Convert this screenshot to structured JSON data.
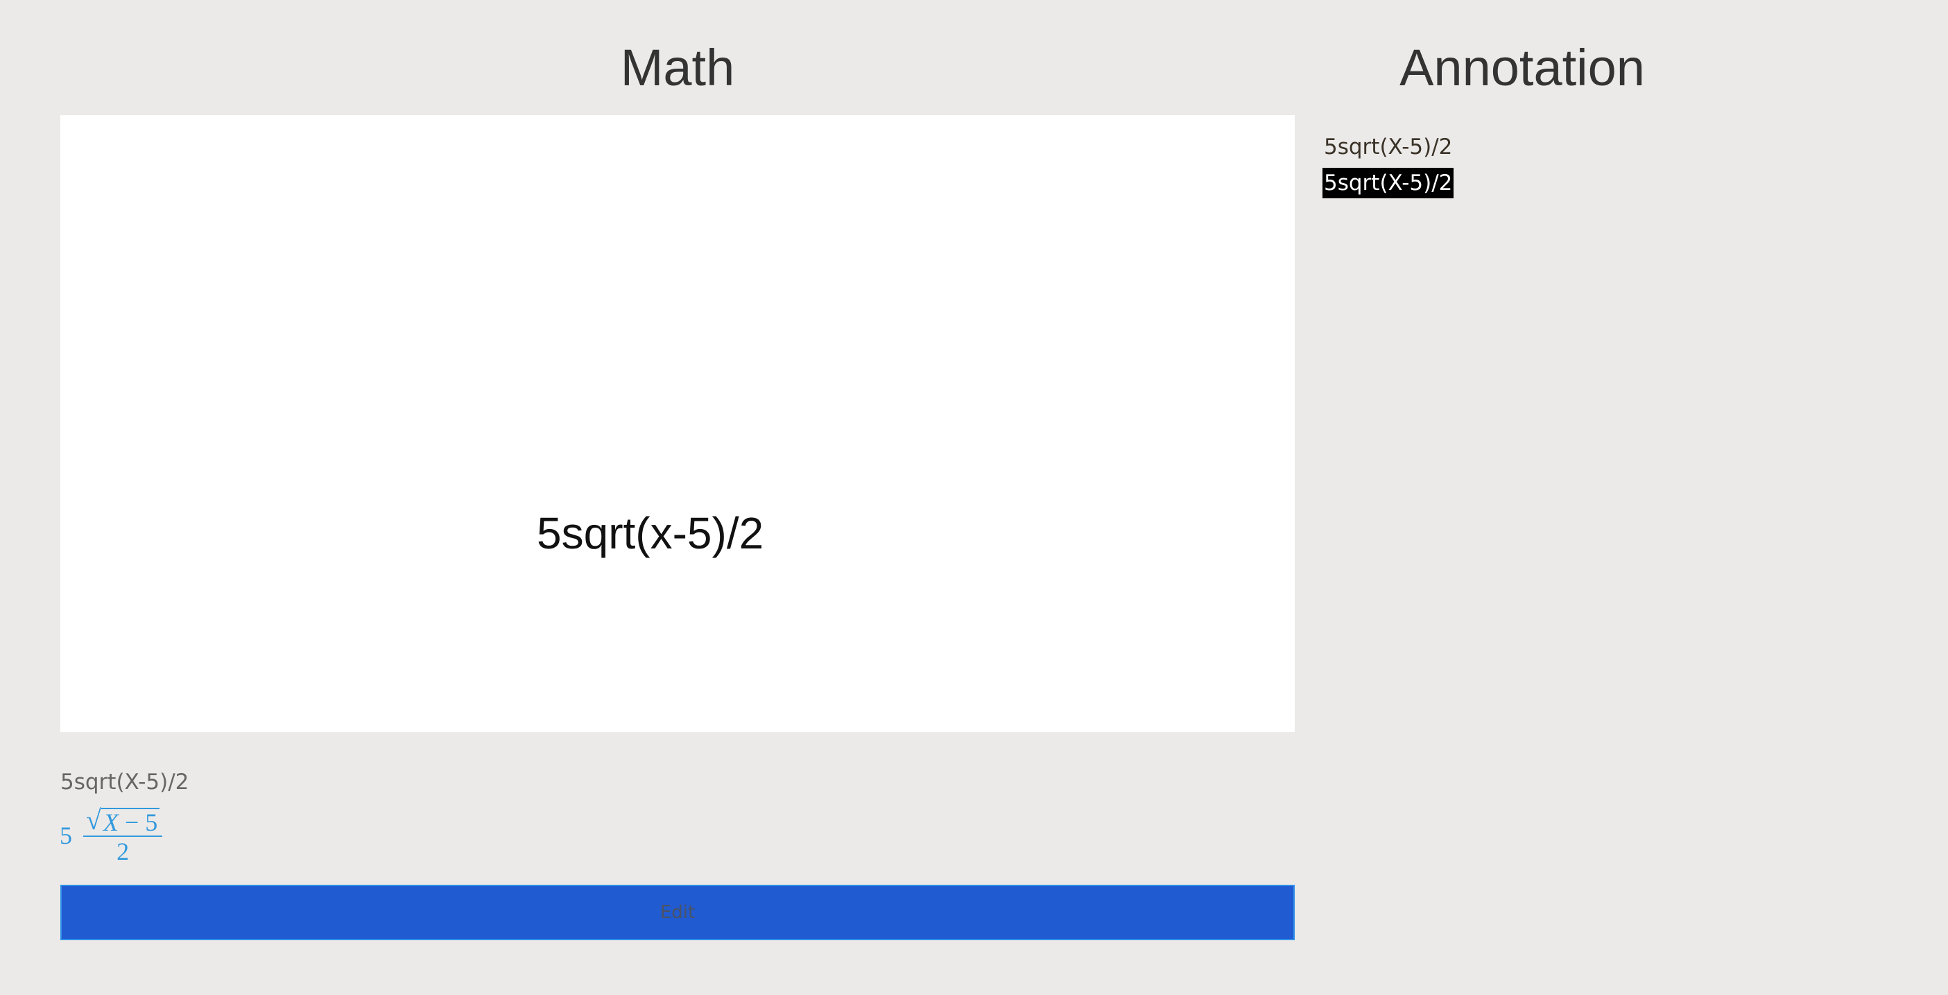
{
  "math_panel": {
    "title": "Math",
    "canvas_text": "5sqrt(x-5)/2",
    "source_text": "5sqrt(X-5)/2",
    "rendered": {
      "coefficient": "5",
      "radicand_variable": "X",
      "radicand_operator": "−",
      "radicand_constant": "5",
      "denominator": "2"
    },
    "edit_label": "Edit"
  },
  "annotation_panel": {
    "title": "Annotation",
    "items": [
      {
        "label": "5sqrt(X-5)/2",
        "selected": false
      },
      {
        "label": "5sqrt(X-5)/2",
        "selected": true
      }
    ]
  },
  "colors": {
    "background": "#ebeae8",
    "canvas": "#ffffff",
    "rendered_math": "#3399dd",
    "edit_button": "#215bd1",
    "selection": "#000000"
  },
  "icons": {
    "radical": "square-root-icon"
  }
}
